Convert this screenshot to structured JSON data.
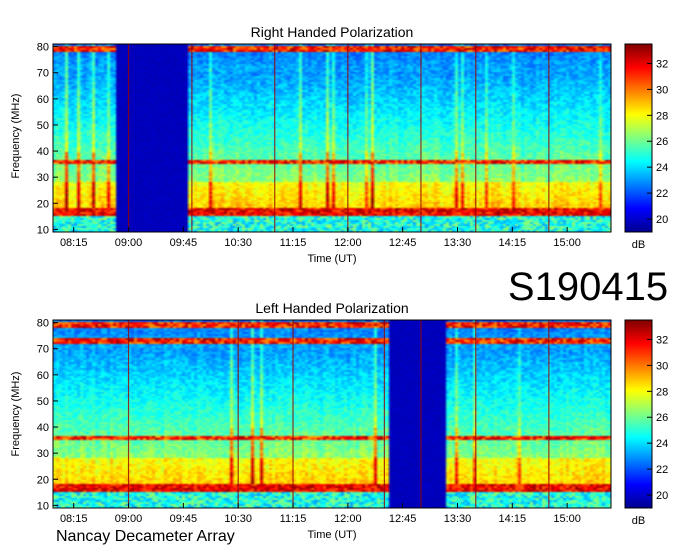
{
  "header": {
    "observation_id": "S190415"
  },
  "footer": {
    "instrument": "Nancay Decameter Array"
  },
  "chart_data": [
    {
      "type": "heatmap",
      "title": "Right Handed Polarization",
      "xlabel": "Time (UT)",
      "ylabel": "Frequency (MHz)",
      "x_tick_labels": [
        "08:15",
        "09:00",
        "09:45",
        "10:30",
        "11:15",
        "12:00",
        "12:45",
        "13:30",
        "14:15",
        "15:00"
      ],
      "y_tick_labels": [
        "10",
        "20",
        "30",
        "40",
        "50",
        "60",
        "70",
        "80"
      ],
      "xlim": [
        "07:58",
        "15:36"
      ],
      "ylim": [
        9,
        81
      ],
      "colorbar": {
        "label": "dB",
        "ticks": [
          "20",
          "22",
          "24",
          "26",
          "28",
          "30",
          "32"
        ],
        "range": [
          19,
          33.5
        ],
        "colormap": "jet"
      },
      "data_gap": {
        "start": "08:50",
        "end": "09:50",
        "description": "no data"
      },
      "strong_emission_band_mhz": [
        15,
        18
      ],
      "rfi_lines_mhz": [
        36,
        79
      ],
      "vertical_interference_times": [
        "09:00",
        "09:52",
        "11:00",
        "12:00",
        "13:00",
        "13:45",
        "14:45"
      ]
    },
    {
      "type": "heatmap",
      "title": "Left Handed Polarization",
      "xlabel": "Time (UT)",
      "ylabel": "Frequency (MHz)",
      "x_tick_labels": [
        "08:15",
        "09:00",
        "09:45",
        "10:30",
        "11:15",
        "12:00",
        "12:45",
        "13:30",
        "14:15",
        "15:00"
      ],
      "y_tick_labels": [
        "10",
        "20",
        "30",
        "40",
        "50",
        "60",
        "70",
        "80"
      ],
      "xlim": [
        "07:58",
        "15:36"
      ],
      "ylim": [
        9,
        81
      ],
      "colorbar": {
        "label": "dB",
        "ticks": [
          "20",
          "22",
          "24",
          "26",
          "28",
          "30",
          "32"
        ],
        "range": [
          19,
          33.5
        ],
        "colormap": "jet"
      },
      "data_gap": {
        "start": "12:35",
        "end": "13:20",
        "description": "no data"
      },
      "strong_emission_band_mhz": [
        15,
        18
      ],
      "rfi_lines_mhz": [
        36,
        73,
        79
      ],
      "vertical_interference_times": [
        "09:00",
        "10:30",
        "11:15",
        "12:30",
        "13:00",
        "13:45",
        "14:45"
      ]
    }
  ]
}
